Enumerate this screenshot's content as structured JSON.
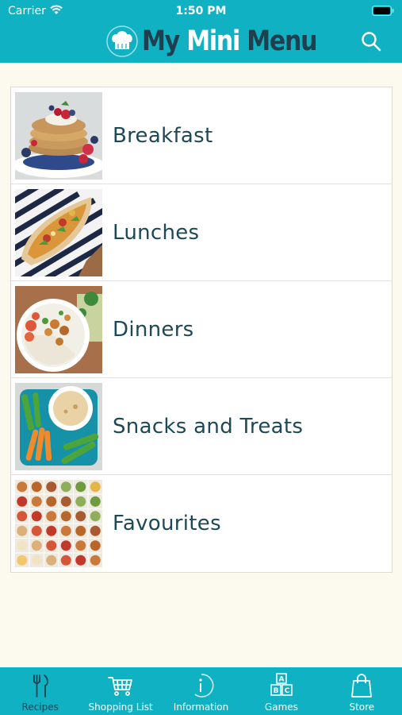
{
  "status_bar": {
    "carrier": "Carrier",
    "time": "1:50 PM"
  },
  "header": {
    "logo_my": "My ",
    "logo_mini": "Mini",
    "logo_menu": " Menu",
    "search_icon": "search-icon"
  },
  "categories": [
    {
      "label": "Breakfast",
      "icon": "pancakes-photo"
    },
    {
      "label": "Lunches",
      "icon": "pizza-wrap-photo"
    },
    {
      "label": "Dinners",
      "icon": "chicken-rice-photo"
    },
    {
      "label": "Snacks and Treats",
      "icon": "veggies-hummus-photo"
    },
    {
      "label": "Favourites",
      "icon": "recipe-collage-photo"
    }
  ],
  "tabs": [
    {
      "label": "Recipes",
      "icon": "cutlery-icon",
      "active": true
    },
    {
      "label": "Shopping List",
      "icon": "shopping-cart-icon",
      "active": false
    },
    {
      "label": "Information",
      "icon": "info-icon",
      "active": false
    },
    {
      "label": "Games",
      "icon": "abc-blocks-icon",
      "active": false
    },
    {
      "label": "Store",
      "icon": "shopping-bag-icon",
      "active": false
    }
  ],
  "colors": {
    "header": "#0fb1c2",
    "background": "#fcfaee",
    "label": "#1e4855",
    "tab_active": "#1f4251"
  }
}
